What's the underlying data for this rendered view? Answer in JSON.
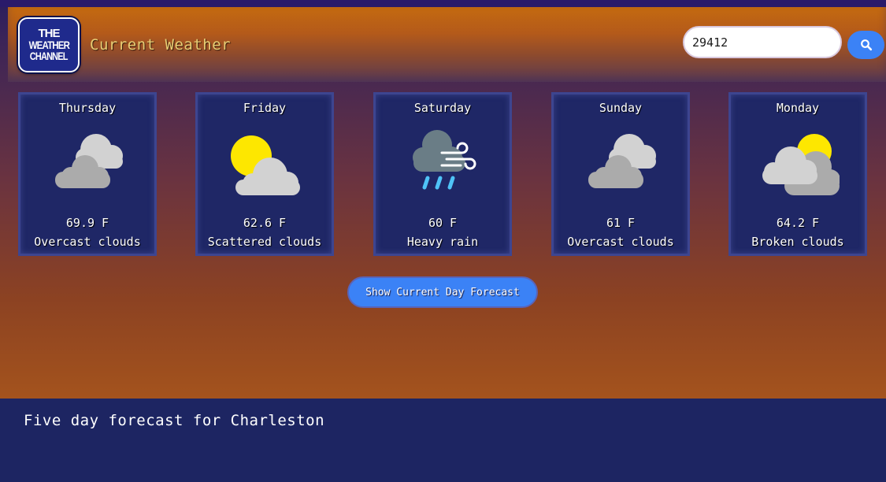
{
  "header": {
    "logo": {
      "line1": "THE",
      "line2": "WEATHER",
      "line3": "CHANNEL"
    },
    "title": "Current Weather",
    "search": {
      "value": "29412",
      "icon": "search-icon"
    }
  },
  "forecast": [
    {
      "day": "Thursday",
      "temp": "69.9 F",
      "description": "Overcast clouds",
      "icon": "overcast-clouds-icon"
    },
    {
      "day": "Friday",
      "temp": "62.6 F",
      "description": "Scattered clouds",
      "icon": "sun-behind-cloud-icon"
    },
    {
      "day": "Saturday",
      "temp": "60 F",
      "description": "Heavy rain",
      "icon": "wind-rain-cloud-icon"
    },
    {
      "day": "Sunday",
      "temp": "61 F",
      "description": "Overcast clouds",
      "icon": "overcast-clouds-icon"
    },
    {
      "day": "Monday",
      "temp": "64.2 F",
      "description": "Broken clouds",
      "icon": "broken-clouds-icon"
    }
  ],
  "actions": {
    "show_current_day": "Show Current Day Forecast"
  },
  "footer": {
    "text": "Five day forecast for Charleston"
  },
  "colors": {
    "accent_blue": "#3b82f6",
    "card_bg": "#1f2766",
    "title_gold": "#e8ce74",
    "sun_yellow": "#fde700",
    "rain_blue": "#4fc3f7"
  }
}
